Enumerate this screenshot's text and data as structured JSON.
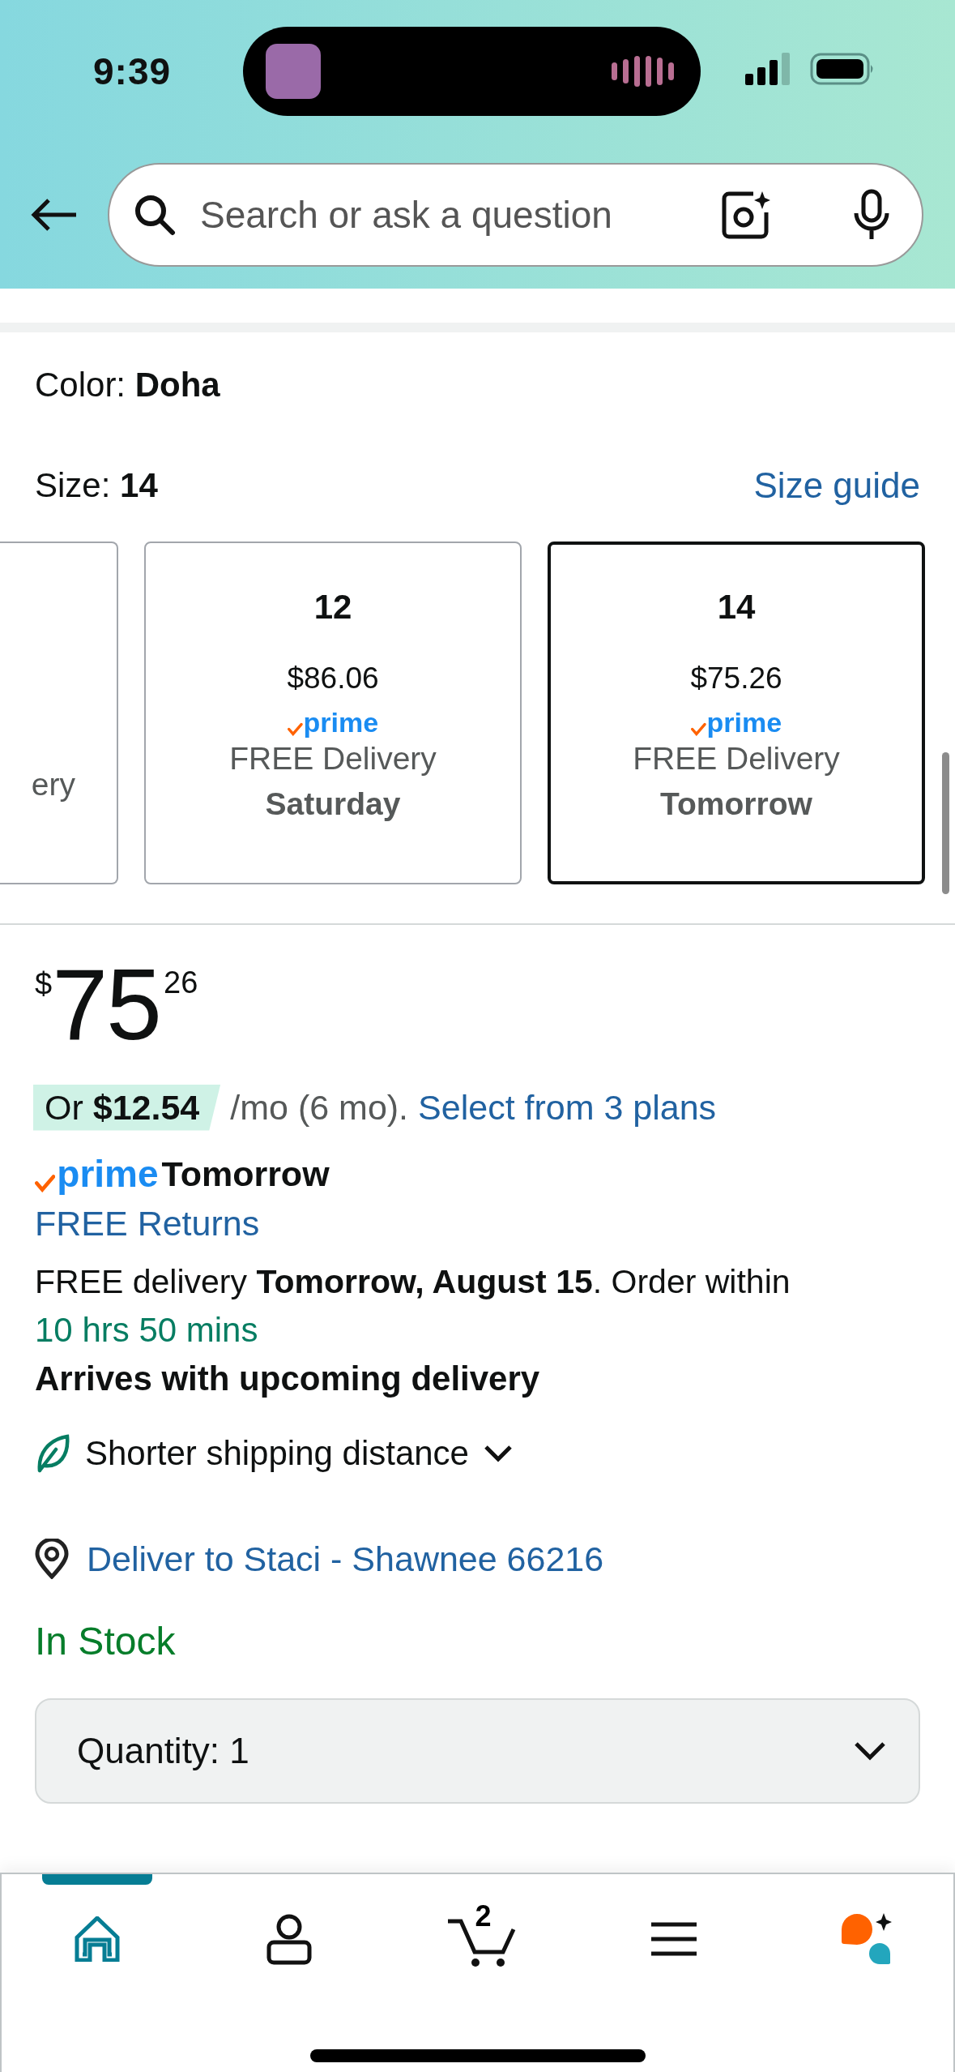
{
  "status_bar": {
    "time": "9:39"
  },
  "search": {
    "placeholder": "Search or ask a question"
  },
  "variation": {
    "color_label": "Color:",
    "color_value": "Doha",
    "size_label": "Size:",
    "size_value": "14",
    "size_guide": "Size guide"
  },
  "size_options": [
    {
      "kind": "partial",
      "delivery": "ery",
      "selected": false
    },
    {
      "kind": "full",
      "size": "12",
      "price": "$86.06",
      "badge": "prime",
      "delivery": "FREE Delivery",
      "day": "Saturday",
      "selected": false
    },
    {
      "kind": "full",
      "size": "14",
      "price": "$75.26",
      "badge": "prime",
      "delivery": "FREE Delivery",
      "day": "Tomorrow",
      "selected": true
    }
  ],
  "price": {
    "currency": "$",
    "whole": "75",
    "fraction": "26"
  },
  "installment": {
    "offer": "Or **$12.54**",
    "terms": "/mo (6 mo).",
    "link": "Select from 3 plans"
  },
  "prime_delivery": {
    "badge": "prime",
    "day": "Tomorrow"
  },
  "returns": "FREE Returns",
  "delivery": {
    "text": "FREE delivery **Tomorrow, August 15**. Order within",
    "countdown": "10 hrs 50 mins",
    "note": "Arrives with upcoming delivery"
  },
  "sustainability": {
    "label": "Shorter shipping distance",
    "expanded": false
  },
  "location": "Deliver to Staci - Shawnee 66216",
  "stock": "In Stock",
  "quantity": {
    "label": "Quantity:",
    "value": "1"
  },
  "nav": [
    {
      "kind": "home",
      "selected": true
    },
    {
      "kind": "account",
      "selected": false
    },
    {
      "kind": "cart",
      "count": "2",
      "selected": false
    },
    {
      "kind": "menu",
      "selected": false
    },
    {
      "kind": "assistant",
      "selected": false
    }
  ]
}
